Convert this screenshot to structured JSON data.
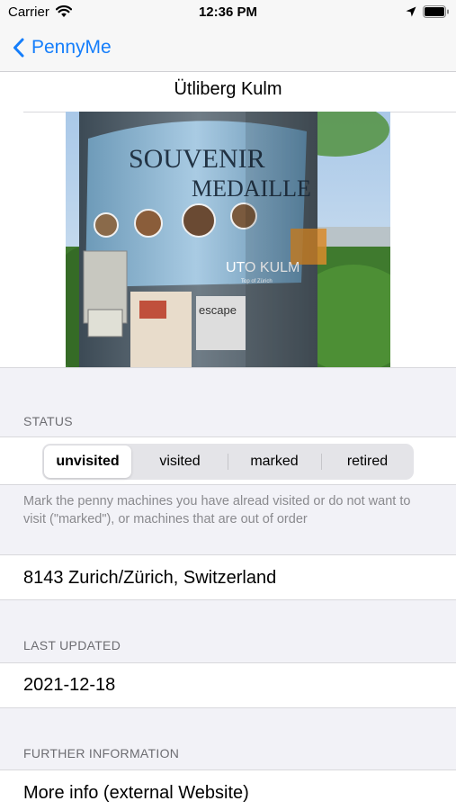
{
  "status_bar": {
    "carrier": "Carrier",
    "time": "12:36 PM"
  },
  "nav": {
    "back_label": "PennyMe"
  },
  "machine": {
    "title": "Ütliberg Kulm"
  },
  "photo": {
    "sign_line1": "SOUVENIR",
    "sign_line2": "MEDAILLE",
    "sign_brand": "UTO KULM",
    "sign_sub": "Top of Zürich",
    "sticker": "escape"
  },
  "status_section": {
    "header": "STATUS",
    "segments": [
      "unvisited",
      "visited",
      "marked",
      "retired"
    ],
    "selected": "unvisited",
    "footer": "Mark the penny machines you have alread visited or do not want to visit (\"marked\"), or machines that are out of order"
  },
  "address": "8143 Zurich/Zürich, Switzerland",
  "last_updated": {
    "header": "LAST UPDATED",
    "value": "2021-12-18"
  },
  "further_info": {
    "header": "FURTHER INFORMATION",
    "link": "More info (external Website)"
  },
  "colors": {
    "accent": "#157efb",
    "background": "#f2f2f7",
    "header_text": "#6d6d72"
  }
}
